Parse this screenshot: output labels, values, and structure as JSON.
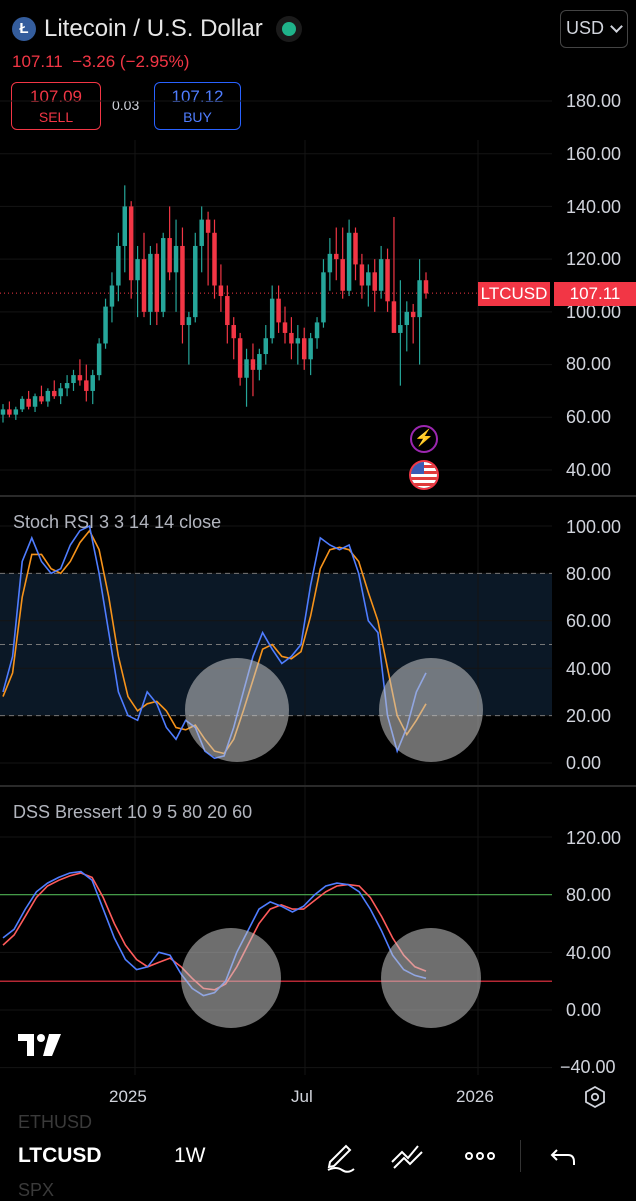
{
  "header": {
    "logo_glyph": "Ł",
    "title": "Litecoin / U.S. Dollar",
    "currency": "USD",
    "last_price": "107.11",
    "change": "−3.26 (−2.95%)",
    "sell_price": "107.09",
    "sell_label": "SELL",
    "spread": "0.03",
    "buy_price": "107.12",
    "buy_label": "BUY"
  },
  "price_pane": {
    "y_ticks": [
      "180.00",
      "160.00",
      "140.00",
      "120.00",
      "100.00",
      "80.00",
      "60.00",
      "40.00"
    ],
    "symbol_tag": "LTCUSD",
    "price_tag": "107.11"
  },
  "stoch_pane": {
    "label": "Stoch RSI 3 3 14 14 close",
    "y_ticks": [
      "100.00",
      "80.00",
      "60.00",
      "40.00",
      "20.00",
      "0.00"
    ]
  },
  "dss_pane": {
    "label": "DSS Bressert 10 9 5 80 20 60",
    "y_ticks": [
      "120.00",
      "80.00",
      "40.00",
      "0.00",
      "−40.00"
    ]
  },
  "x_axis": {
    "labels": [
      "2025",
      "Jul",
      "2026"
    ]
  },
  "toolbar": {
    "symbol": "LTCUSD",
    "timeframe": "1W",
    "ghost_above": "ETHUSD",
    "ghost_below": "SPX"
  },
  "colors": {
    "up": "#26a69a",
    "down": "#f23645",
    "blue": "#4f7dff",
    "orange": "#f7931a"
  },
  "chart_data": [
    {
      "type": "candlestick",
      "title": "Litecoin / U.S. Dollar",
      "ylim": [
        35,
        190
      ],
      "candles": [
        [
          61,
          65,
          58,
          63
        ],
        [
          63,
          66,
          60,
          61
        ],
        [
          61,
          64,
          59,
          63
        ],
        [
          63,
          68,
          62,
          67
        ],
        [
          67,
          70,
          63,
          64
        ],
        [
          64,
          69,
          62,
          68
        ],
        [
          68,
          72,
          65,
          66
        ],
        [
          66,
          71,
          64,
          70
        ],
        [
          70,
          74,
          67,
          68
        ],
        [
          68,
          73,
          65,
          71
        ],
        [
          71,
          76,
          68,
          73
        ],
        [
          73,
          78,
          70,
          76
        ],
        [
          76,
          82,
          72,
          74
        ],
        [
          74,
          80,
          66,
          70
        ],
        [
          70,
          78,
          65,
          76
        ],
        [
          76,
          90,
          74,
          88
        ],
        [
          88,
          105,
          86,
          102
        ],
        [
          102,
          115,
          96,
          110
        ],
        [
          110,
          130,
          104,
          125
        ],
        [
          125,
          148,
          115,
          140
        ],
        [
          140,
          142,
          105,
          112
        ],
        [
          112,
          125,
          98,
          120
        ],
        [
          120,
          130,
          98,
          100
        ],
        [
          100,
          125,
          95,
          122
        ],
        [
          122,
          126,
          95,
          100
        ],
        [
          100,
          130,
          98,
          128
        ],
        [
          128,
          140,
          112,
          115
        ],
        [
          115,
          135,
          100,
          125
        ],
        [
          125,
          132,
          88,
          95
        ],
        [
          95,
          100,
          80,
          98
        ],
        [
          98,
          130,
          96,
          125
        ],
        [
          125,
          140,
          115,
          135
        ],
        [
          135,
          138,
          110,
          130
        ],
        [
          130,
          135,
          105,
          110
        ],
        [
          110,
          118,
          100,
          106
        ],
        [
          106,
          110,
          88,
          95
        ],
        [
          95,
          98,
          82,
          90
        ],
        [
          90,
          92,
          72,
          75
        ],
        [
          75,
          86,
          64,
          82
        ],
        [
          82,
          88,
          68,
          78
        ],
        [
          78,
          86,
          74,
          84
        ],
        [
          84,
          95,
          80,
          90
        ],
        [
          90,
          110,
          88,
          105
        ],
        [
          105,
          110,
          92,
          96
        ],
        [
          96,
          102,
          88,
          92
        ],
        [
          92,
          98,
          82,
          88
        ],
        [
          88,
          95,
          80,
          90
        ],
        [
          90,
          94,
          78,
          82
        ],
        [
          82,
          92,
          76,
          90
        ],
        [
          90,
          98,
          86,
          96
        ],
        [
          96,
          120,
          94,
          115
        ],
        [
          115,
          128,
          108,
          122
        ],
        [
          122,
          132,
          112,
          120
        ],
        [
          120,
          132,
          105,
          108
        ],
        [
          108,
          135,
          106,
          130
        ],
        [
          130,
          132,
          112,
          118
        ],
        [
          118,
          122,
          105,
          110
        ],
        [
          110,
          118,
          102,
          115
        ],
        [
          115,
          120,
          100,
          108
        ],
        [
          108,
          125,
          105,
          120
        ],
        [
          120,
          124,
          100,
          104
        ],
        [
          104,
          136,
          95,
          92
        ],
        [
          92,
          112,
          72,
          95
        ],
        [
          95,
          104,
          85,
          100
        ],
        [
          100,
          103,
          88,
          98
        ],
        [
          98,
          120,
          80,
          112
        ],
        [
          112,
          115,
          105,
          107
        ]
      ],
      "last": 107.11
    },
    {
      "type": "line",
      "title": "Stoch RSI 3 3 14 14 close",
      "ylim": [
        -5,
        105
      ],
      "bands": [
        20,
        50,
        80
      ],
      "series": [
        {
          "name": "K",
          "values": [
            30,
            45,
            85,
            95,
            85,
            80,
            82,
            92,
            98,
            100,
            80,
            55,
            30,
            20,
            18,
            30,
            25,
            15,
            10,
            18,
            15,
            5,
            2,
            3,
            15,
            30,
            45,
            55,
            48,
            42,
            45,
            50,
            75,
            95,
            92,
            90,
            92,
            80,
            60,
            55,
            20,
            5,
            15,
            30,
            38
          ]
        },
        {
          "name": "D",
          "values": [
            28,
            38,
            70,
            88,
            88,
            82,
            80,
            85,
            93,
            98,
            90,
            70,
            45,
            28,
            22,
            25,
            26,
            22,
            15,
            14,
            16,
            10,
            5,
            4,
            10,
            22,
            35,
            48,
            50,
            45,
            44,
            47,
            62,
            82,
            90,
            91,
            90,
            85,
            72,
            60,
            40,
            20,
            12,
            18,
            25
          ]
        }
      ]
    },
    {
      "type": "line",
      "title": "DSS Bressert 10 9 5 80 20 60",
      "ylim": [
        -45,
        130
      ],
      "levels": [
        80,
        20
      ],
      "series": [
        {
          "name": "blue",
          "values": [
            50,
            56,
            70,
            82,
            88,
            92,
            95,
            96,
            90,
            70,
            50,
            35,
            28,
            30,
            40,
            38,
            25,
            15,
            10,
            12,
            20,
            40,
            55,
            70,
            75,
            72,
            68,
            72,
            80,
            86,
            88,
            87,
            82,
            70,
            55,
            38,
            28,
            24,
            22
          ]
        },
        {
          "name": "red",
          "values": [
            45,
            52,
            65,
            78,
            86,
            90,
            93,
            95,
            92,
            78,
            60,
            45,
            35,
            30,
            33,
            36,
            30,
            22,
            15,
            14,
            18,
            30,
            45,
            60,
            70,
            73,
            70,
            70,
            76,
            82,
            86,
            87,
            86,
            78,
            65,
            50,
            38,
            30,
            27
          ]
        }
      ]
    }
  ]
}
